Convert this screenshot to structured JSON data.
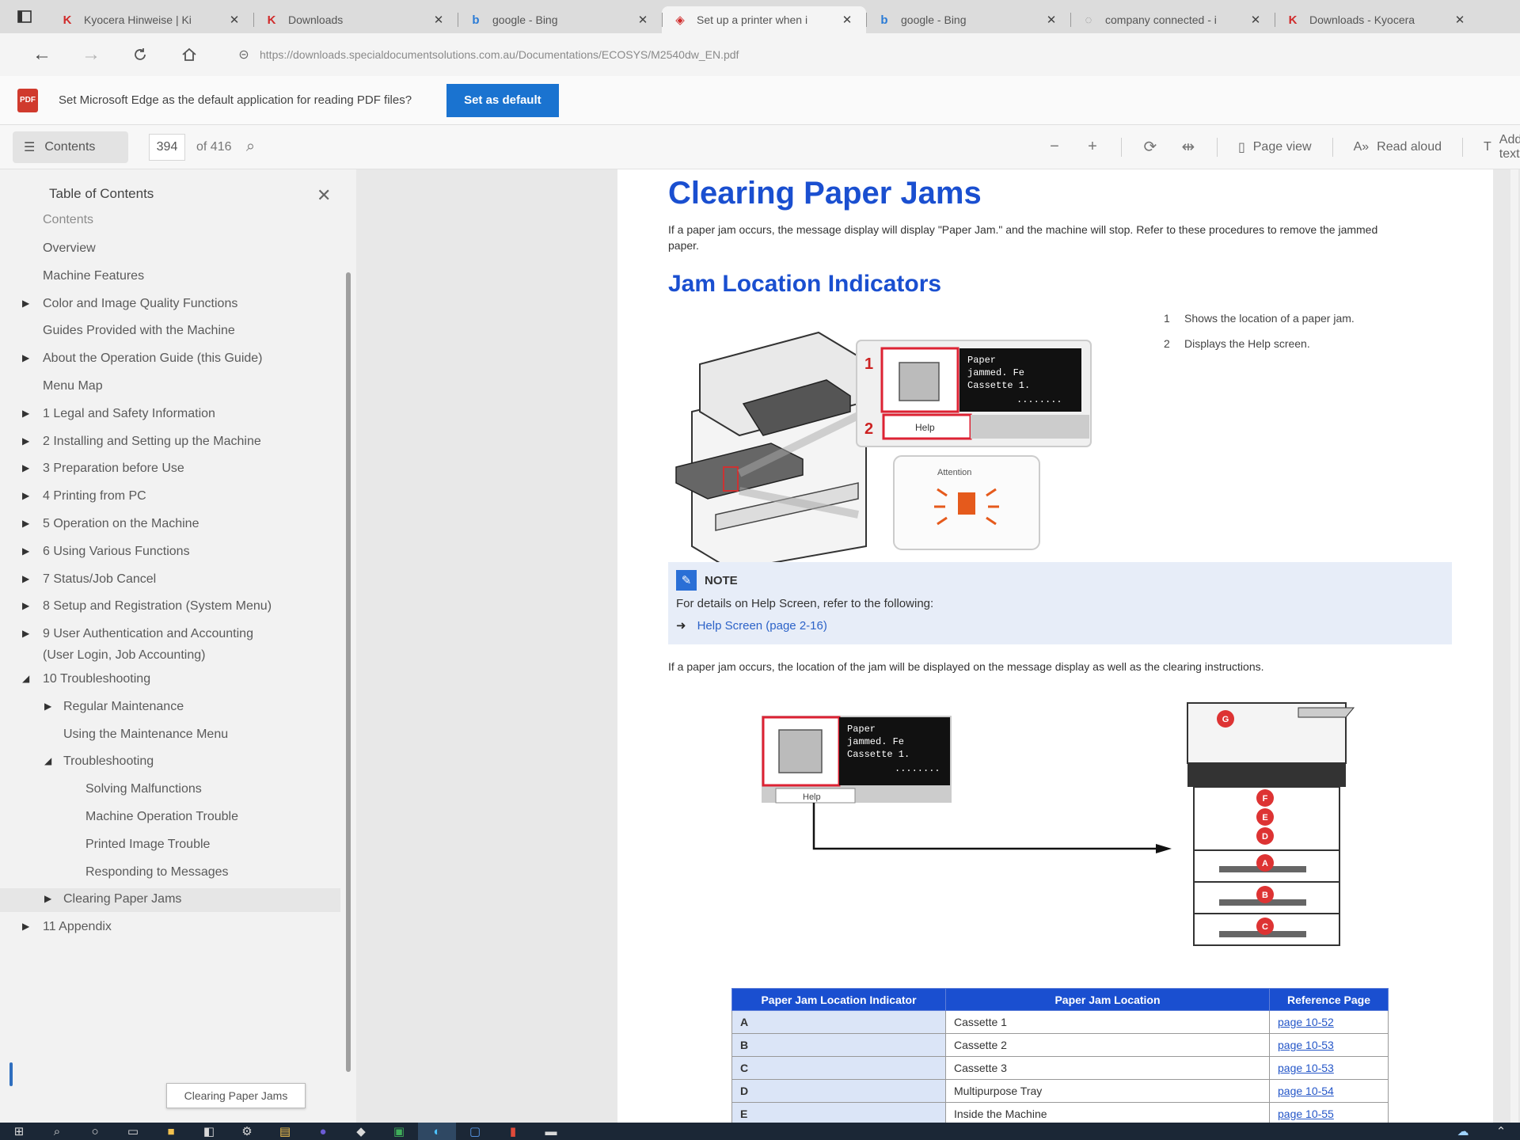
{
  "tabs": [
    {
      "title": "Kyocera Hinweise | Ki",
      "favicon": "kyocera-icon",
      "color": "#d02a2a"
    },
    {
      "title": "Downloads",
      "favicon": "kyocera-icon",
      "color": "#d02a2a"
    },
    {
      "title": "google - Bing",
      "favicon": "bing-icon",
      "color": "#2a7bd6"
    },
    {
      "title": "Set up a printer when i",
      "favicon": "printer-icon",
      "color": "#d02a2a"
    },
    {
      "title": "google - Bing",
      "favicon": "bing-icon",
      "color": "#2a7bd6"
    },
    {
      "title": "company connected - i",
      "favicon": "loading-icon",
      "color": "#888888"
    },
    {
      "title": "Downloads - Kyocera",
      "favicon": "kyocera-icon",
      "color": "#d02a2a"
    }
  ],
  "address": {
    "url": "https://downloads.specialdocumentsolutions.com.au/Documentations/ECOSYS/M2540dw_EN.pdf"
  },
  "infobar": {
    "message": "Set Microsoft Edge as the default application for reading PDF files?",
    "button": "Set as default"
  },
  "pdf_toolbar": {
    "contents": "Contents",
    "page": "394",
    "page_count": "of 416",
    "page_view": "Page view",
    "read_aloud": "Read aloud",
    "add_text": "Add text"
  },
  "toc": {
    "title": "Table of Contents",
    "items": [
      {
        "label": "Contents",
        "level": 0,
        "arrow": ""
      },
      {
        "label": "Overview",
        "level": 0,
        "arrow": ""
      },
      {
        "label": "Machine Features",
        "level": 0,
        "arrow": ""
      },
      {
        "label": "Color and Image Quality Functions",
        "level": 0,
        "arrow": "▶"
      },
      {
        "label": "Guides Provided with the Machine",
        "level": 0,
        "arrow": ""
      },
      {
        "label": "About the Operation Guide (this Guide)",
        "level": 0,
        "arrow": "▶"
      },
      {
        "label": "Menu Map",
        "level": 0,
        "arrow": ""
      },
      {
        "label": "1 Legal and Safety Information",
        "level": 0,
        "arrow": "▶"
      },
      {
        "label": "2 Installing and Setting up the Machine",
        "level": 0,
        "arrow": "▶"
      },
      {
        "label": "3 Preparation before Use",
        "level": 0,
        "arrow": "▶"
      },
      {
        "label": "4 Printing from PC",
        "level": 0,
        "arrow": "▶"
      },
      {
        "label": "5 Operation on the Machine",
        "level": 0,
        "arrow": "▶"
      },
      {
        "label": "6 Using Various Functions",
        "level": 0,
        "arrow": "▶"
      },
      {
        "label": "7 Status/Job Cancel",
        "level": 0,
        "arrow": "▶"
      },
      {
        "label": "8 Setup and Registration (System Menu)",
        "level": 0,
        "arrow": "▶"
      },
      {
        "label": "9 User Authentication and Accounting",
        "label2": "(User Login, Job Accounting)",
        "level": 0,
        "arrow": "▶"
      },
      {
        "label": "10 Troubleshooting",
        "level": 0,
        "arrow": "◢"
      },
      {
        "label": "Regular Maintenance",
        "level": 1,
        "arrow": "▶"
      },
      {
        "label": "Using the Maintenance Menu",
        "level": 1,
        "arrow": ""
      },
      {
        "label": "Troubleshooting",
        "level": 1,
        "arrow": "◢"
      },
      {
        "label": "Solving Malfunctions",
        "level": 2,
        "arrow": ""
      },
      {
        "label": "Machine Operation Trouble",
        "level": 2,
        "arrow": ""
      },
      {
        "label": "Printed Image Trouble",
        "level": 2,
        "arrow": ""
      },
      {
        "label": "Responding to Messages",
        "level": 2,
        "arrow": ""
      },
      {
        "label": "Clearing Paper Jams",
        "level": 1,
        "arrow": "▶"
      },
      {
        "label": "11 Appendix",
        "level": 0,
        "arrow": "▶"
      }
    ],
    "tooltip": "Clearing Paper Jams"
  },
  "doc": {
    "title": "Clearing Paper Jams",
    "intro": "If a paper jam occurs, the message display will display \"Paper Jam.\" and the machine will stop. Refer to these procedures to remove the jammed paper.",
    "subtitle": "Jam Location Indicators",
    "legend": [
      {
        "num": "1",
        "text": "Shows the location of a paper jam."
      },
      {
        "num": "2",
        "text": "Displays the Help screen."
      }
    ],
    "fig1": {
      "screen_text": [
        "Paper",
        "jammed. Fe",
        "Cassette 1.",
        "........"
      ],
      "help_label": "Help",
      "callouts": [
        "1",
        "2"
      ],
      "attention_label": "Attention"
    },
    "note": {
      "heading": "NOTE",
      "text": "For details on Help Screen, refer to the following:",
      "link": "Help Screen (page 2-16)"
    },
    "para2": "If a paper jam occurs, the location of the jam will be displayed on the message display as well as the clearing instructions.",
    "fig2": {
      "screen_text": [
        "Paper",
        "jammed. Fe",
        "Cassette 1.",
        "........"
      ],
      "help_label": "Help",
      "markers": [
        "A",
        "B",
        "C",
        "D",
        "E",
        "F",
        "G"
      ]
    },
    "table": {
      "headers": [
        "Paper Jam Location Indicator",
        "Paper Jam Location",
        "Reference Page"
      ],
      "rows": [
        [
          "A",
          "Cassette 1",
          "page 10-52"
        ],
        [
          "B",
          "Cassette 2",
          "page 10-53"
        ],
        [
          "C",
          "Cassette 3",
          "page 10-53"
        ],
        [
          "D",
          "Multipurpose Tray",
          "page 10-54"
        ],
        [
          "E",
          "Inside the Machine",
          "page 10-55"
        ]
      ]
    }
  },
  "colors": {
    "accent": "#1a4fd0",
    "edge_blue": "#1a73d0",
    "taskbar": "#1b2736"
  }
}
